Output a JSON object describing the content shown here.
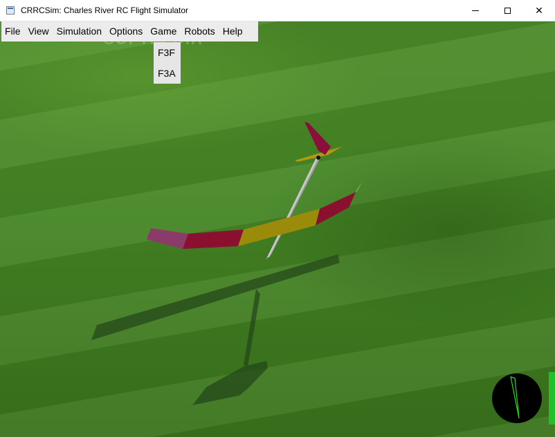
{
  "window": {
    "title": "CRRCSim: Charles River RC Flight Simulator",
    "controls": {
      "minimize_icon": "minimize-icon",
      "maximize_icon": "maximize-icon",
      "close_glyph": "✕"
    }
  },
  "menubar": {
    "items": [
      {
        "label": "File"
      },
      {
        "label": "View"
      },
      {
        "label": "Simulation"
      },
      {
        "label": "Options"
      },
      {
        "label": "Game"
      },
      {
        "label": "Robots"
      },
      {
        "label": "Help"
      }
    ]
  },
  "game_menu": {
    "items": [
      {
        "label": "F3F"
      },
      {
        "label": "F3A"
      }
    ]
  },
  "watermark": "SOFTPEDIA",
  "hud": {
    "compass_icon": "compass-icon",
    "throttle_level": 1.0
  },
  "colors": {
    "grass": "#3f7a23",
    "wing_tip": "#8b3a6a",
    "wing_mid": "#8b0f2e",
    "wing_center": "#9a8c0a",
    "compass_needle": "#22dd22",
    "throttle": "#21c02a"
  }
}
